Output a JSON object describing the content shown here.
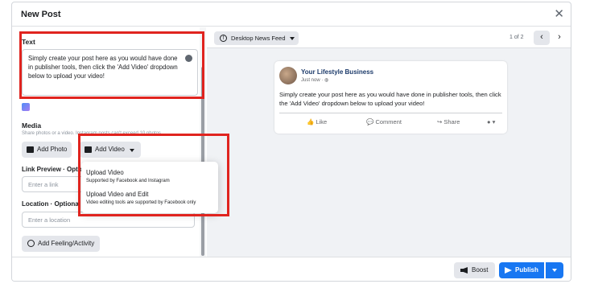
{
  "header": {
    "title": "New Post",
    "close": "✕"
  },
  "text_section": {
    "label": "Text",
    "content": "Simply create your post here as you would have done in publisher tools, then click the 'Add Video' dropdown below to upload your video!"
  },
  "media": {
    "label": "Media",
    "hint": "Share photos or a video. Instagram posts can't exceed 10 photos.",
    "add_photo": "Add Photo",
    "add_video": "Add Video"
  },
  "video_menu": {
    "items": [
      {
        "title": "Upload Video",
        "desc": "Supported by Facebook and Instagram"
      },
      {
        "title": "Upload Video and Edit",
        "desc": "Video editing tools are supported by Facebook only"
      }
    ]
  },
  "link_preview": {
    "label": "Link Preview · Optional",
    "placeholder": "Enter a link"
  },
  "location": {
    "label": "Location · Optional",
    "placeholder": "Enter a location"
  },
  "feeling": {
    "label": "Add Feeling/Activity"
  },
  "preview": {
    "feed_select": "Desktop News Feed",
    "fb_glyph": "f",
    "pager": "1 of 2",
    "prev": "‹",
    "next": "›"
  },
  "post": {
    "page_name": "Your Lifestyle Business",
    "time": "Just now · ◍",
    "text": "Simply create your post here as you would have done in publisher tools, then click the 'Add Video' dropdown below to upload your video!",
    "like": "Like",
    "comment": "Comment",
    "share": "Share"
  },
  "footer": {
    "boost": "Boost",
    "publish": "Publish"
  },
  "colors": {
    "primary": "#1877f2",
    "highlight": "#e0241f",
    "page_bg": "#f0f2f5"
  },
  "icons": [
    "close-icon",
    "emoji-icon",
    "ai-assist-icon",
    "photo-icon",
    "video-icon",
    "chevron-down-icon",
    "facebook-icon",
    "chevron-left-icon",
    "chevron-right-icon",
    "like-icon",
    "comment-icon",
    "share-icon",
    "smile-icon",
    "megaphone-icon",
    "send-icon"
  ]
}
